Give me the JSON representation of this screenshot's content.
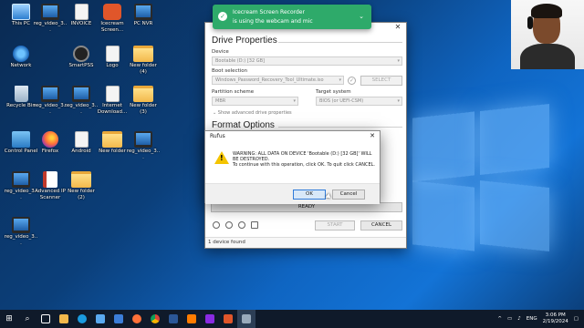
{
  "desktop": {
    "icons": [
      {
        "label": "This PC",
        "icon": "pc"
      },
      {
        "label": "reg_video_3...",
        "icon": "monitor"
      },
      {
        "label": "INVOICE",
        "icon": "doc"
      },
      {
        "label": "Icecream Screen...",
        "icon": "rec"
      },
      {
        "label": "PC NVR",
        "icon": "monitor"
      },
      {
        "label": "Network",
        "icon": "net"
      },
      {
        "label": "SmartPSS",
        "icon": "smart"
      },
      {
        "label": "Logo",
        "icon": "doc"
      },
      {
        "label": "New folder (4)",
        "icon": "folder"
      },
      {
        "label": "Recycle Bin",
        "icon": "bin"
      },
      {
        "label": "reg_video_3...",
        "icon": "monitor"
      },
      {
        "label": "reg_video_3...",
        "icon": "monitor"
      },
      {
        "label": "Internet Download...",
        "icon": "doc"
      },
      {
        "label": "New folder (3)",
        "icon": "folder"
      },
      {
        "label": "Control Panel",
        "icon": "panel"
      },
      {
        "label": "Firefox",
        "icon": "firefox"
      },
      {
        "label": "Android",
        "icon": "doc"
      },
      {
        "label": "New folder",
        "icon": "folder"
      },
      {
        "label": "reg_video_3...",
        "icon": "monitor"
      },
      {
        "label": "reg_video_3...",
        "icon": "monitor"
      },
      {
        "label": "Advanced IP Scanner",
        "icon": "pdf"
      },
      {
        "label": "New folder (2)",
        "icon": "folder"
      },
      {
        "label": "reg_video_3...",
        "icon": "monitor"
      }
    ]
  },
  "toast": {
    "title": "Icecream Screen Recorder",
    "subtitle": "is using the webcam and mic",
    "icon": "shield-check-icon",
    "chevron": "⌄"
  },
  "rufus": {
    "close": "✕",
    "drive_properties": "Drive Properties",
    "device_label": "Device",
    "device_value": "Bootable (D:) [32 GB]",
    "boot_selection_label": "Boot selection",
    "boot_selection_value": "Windows_Password_Recovery_Tool_Ultimate.iso",
    "select_button": "SELECT",
    "partition_label": "Partition scheme",
    "partition_value": "MBR",
    "target_label": "Target system",
    "target_value": "BIOS (or UEFI-CSM)",
    "advanced_toggle": "Show advanced drive properties",
    "format_options": "Format Options",
    "progress_text": "READY",
    "start_button": "START",
    "cancel_button": "CANCEL",
    "status": "1 device found"
  },
  "dialog": {
    "title": "Rufus",
    "close": "✕",
    "warn_mark": "!",
    "message_line1": "WARNING: ALL DATA ON DEVICE 'Bootable (D:) [32 GB]' WILL BE DESTROYED.",
    "message_line2": "To continue with this operation, click OK. To quit click CANCEL.",
    "ok_button": "OK",
    "cancel_button": "Cancel"
  },
  "taskbar": {
    "start_icon": "windows-start-icon",
    "lang": "ENG",
    "time": "3:06 PM",
    "date": "2/19/2024",
    "chevron": "^"
  },
  "colors": {
    "toast": "#2eaa6a",
    "warning": "#f4c400",
    "ok_border": "#2f7bd9"
  }
}
